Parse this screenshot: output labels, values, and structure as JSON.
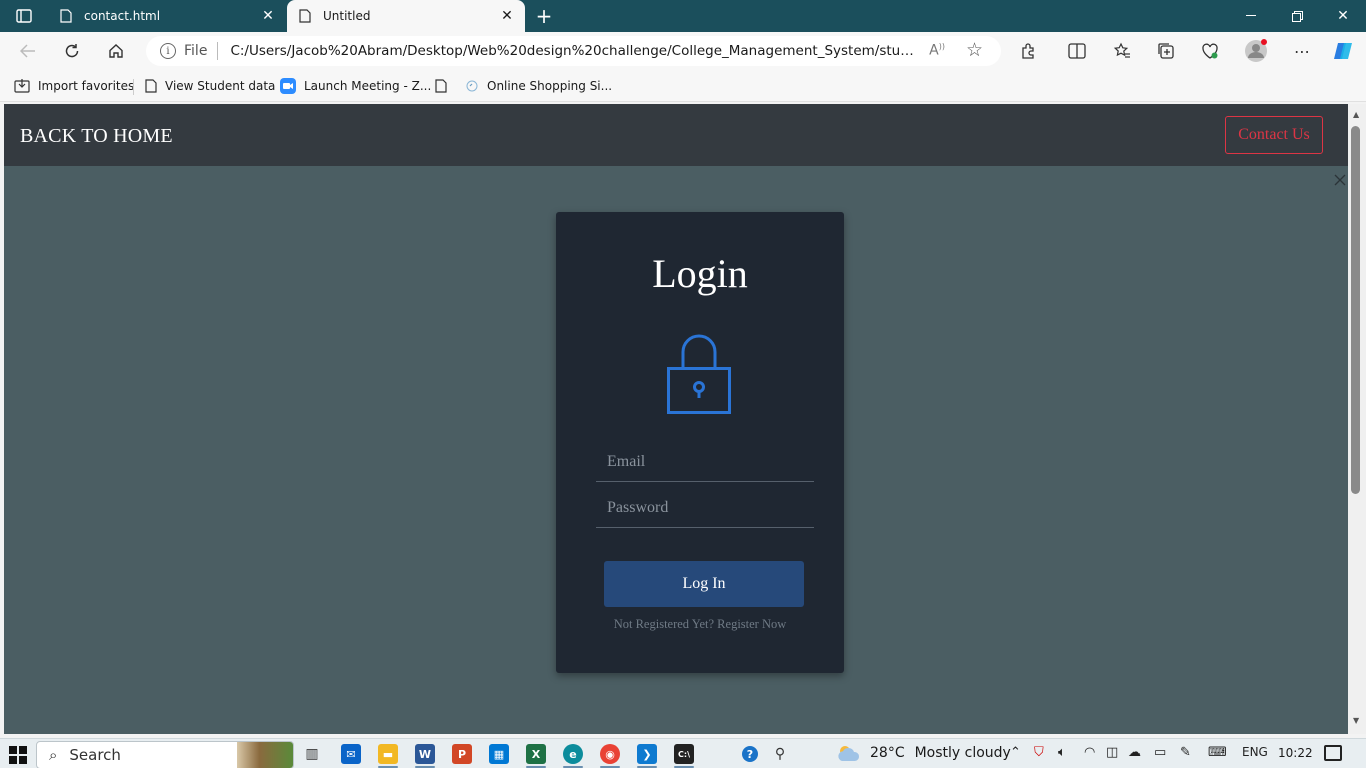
{
  "browser": {
    "tabs": [
      {
        "title": "contact.html",
        "active": false
      },
      {
        "title": "Untitled",
        "active": true
      }
    ],
    "address": {
      "scheme_label": "File",
      "url": "C:/Users/Jacob%20Abram/Desktop/Web%20design%20challenge/College_Management_System/student_ma..."
    },
    "favorites": [
      {
        "label": "Import favorites",
        "icon": "import-icon"
      },
      {
        "label": "View Student data",
        "icon": "page-icon"
      },
      {
        "label": "Launch Meeting - Z...",
        "icon": "zoom-icon"
      },
      {
        "label": "",
        "icon": "page-icon"
      },
      {
        "label": "Online Shopping Si...",
        "icon": "shop-icon"
      }
    ]
  },
  "page": {
    "nav": {
      "home_label": "BACK TO HOME",
      "contact_label": "Contact Us"
    },
    "login": {
      "title": "Login",
      "email_placeholder": "Email",
      "password_placeholder": "Password",
      "submit_label": "Log In",
      "register_text": "Not Registered Yet? Register Now"
    },
    "colors": {
      "page_bg": "#4b5e63",
      "navbar_bg": "#343a40",
      "card_bg": "#1f2732",
      "accent_blue": "#2a74d6",
      "button_bg": "#26497a",
      "contact_red": "#dc3545"
    }
  },
  "taskbar": {
    "search_label": "Search",
    "weather": {
      "temp": "28°C",
      "condition": "Mostly cloudy"
    },
    "language": "ENG",
    "time": "10:22"
  }
}
